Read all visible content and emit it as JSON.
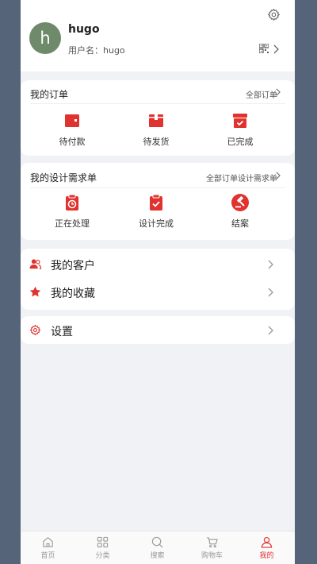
{
  "profile": {
    "avatar_letter": "h",
    "display_name": "hugo",
    "username_label": "用户名：hugo"
  },
  "orders": {
    "title": "我的订单",
    "all_link": "全部订单",
    "items": [
      {
        "label": "待付款",
        "icon": "wallet-icon"
      },
      {
        "label": "待发货",
        "icon": "package-icon"
      },
      {
        "label": "已完成",
        "icon": "box-check-icon"
      }
    ]
  },
  "design": {
    "title": "我的设计需求单",
    "all_link": "全部订单设计需求单",
    "items": [
      {
        "label": "正在处理",
        "icon": "clipboard-clock-icon"
      },
      {
        "label": "设计完成",
        "icon": "clipboard-check-icon"
      },
      {
        "label": "结案",
        "icon": "gavel-icon"
      }
    ]
  },
  "menu": {
    "customers": "我的客户",
    "favorites": "我的收藏",
    "settings": "设置"
  },
  "tabbar": {
    "items": [
      {
        "label": "首页",
        "icon": "home-icon"
      },
      {
        "label": "分类",
        "icon": "category-icon"
      },
      {
        "label": "搜索",
        "icon": "search-icon"
      },
      {
        "label": "购物车",
        "icon": "cart-icon"
      },
      {
        "label": "我的",
        "icon": "user-icon"
      }
    ],
    "active_index": 4
  },
  "colors": {
    "accent": "#e0322e",
    "background": "#f1f2f5",
    "avatar": "#6e8a6b",
    "frame": "#566479"
  }
}
